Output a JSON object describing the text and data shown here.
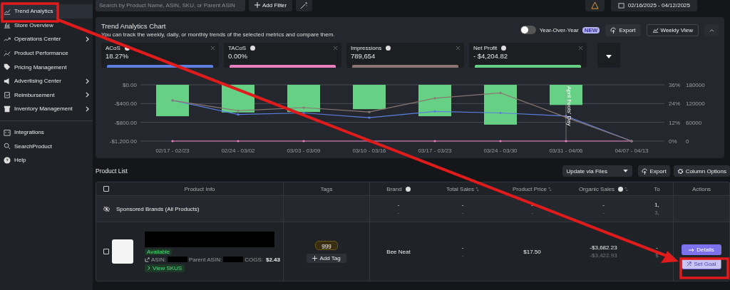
{
  "sidebar": {
    "items": [
      {
        "label": "Trend Analytics",
        "selected": true,
        "expandable": false
      },
      {
        "label": "Store Overview",
        "selected": false,
        "expandable": false
      },
      {
        "label": "Operations Center",
        "selected": false,
        "expandable": true
      },
      {
        "label": "Product Performance",
        "selected": false,
        "expandable": false
      },
      {
        "label": "Pricing Management",
        "selected": false,
        "expandable": false
      },
      {
        "label": "Advertising Center",
        "selected": false,
        "expandable": true
      },
      {
        "label": "Reimbursement",
        "selected": false,
        "expandable": true
      },
      {
        "label": "Inventory Management",
        "selected": false,
        "expandable": true
      }
    ],
    "bottom_items": [
      {
        "label": "Integrations"
      },
      {
        "label": "SearchProduct"
      },
      {
        "label": "Help"
      }
    ]
  },
  "toolbar": {
    "search": {
      "placeholder": "Search by Product Name, ASIN, SKU, or Parent ASIN"
    },
    "add_filter": "Add Filter",
    "date_range": "02/16/2025 - 04/12/2025"
  },
  "chart_panel": {
    "title": "Trend Analytics Chart",
    "subtitle": "You can track the weekly, daily, or monthly trends of the selected metrics and compare them.",
    "year_over_year": {
      "label": "Year-Over-Year",
      "on": false,
      "badge": "NEW"
    },
    "export": "Export",
    "weekly_view": "Weekly View",
    "metrics": [
      {
        "value": "18.27%"
      },
      {
        "value": "0.00%"
      },
      {
        "value": "789,654"
      },
      {
        "value": "- $4,204.82"
      }
    ],
    "chart_data": {
      "type": "bar",
      "stacked": false,
      "categories": [
        "02/17 - 02/23",
        "02/24 - 03/02",
        "03/03 - 03/09",
        "03/10 - 03/16",
        "03/17 - 03/23",
        "03/24 - 03/30",
        "03/31 - 04/06",
        "04/07 - 04/13"
      ],
      "ylim": [
        -1200,
        0
      ],
      "yticks": [
        {
          "value": 0,
          "label": "$0.00"
        },
        {
          "value": -400,
          "label": "-$400.00"
        },
        {
          "value": -800,
          "label": "-$800.00"
        },
        {
          "value": -1200,
          "label": "-$1,200.00"
        }
      ],
      "y2lim": [
        0,
        36
      ],
      "y2ticks": [
        {
          "value": 36,
          "label": "36%"
        },
        {
          "value": 24,
          "label": "24%"
        },
        {
          "value": 12,
          "label": "12%"
        },
        {
          "value": 0,
          "label": "0%"
        }
      ],
      "y3lim": [
        0,
        180000
      ],
      "y3ticks": [
        180000,
        120000,
        60000,
        0
      ],
      "series": [
        {
          "name": "ACoS",
          "color": "#5b7fde",
          "type": "line",
          "axis": "y2",
          "values": [
            26,
            17,
            18,
            15,
            19,
            18,
            16,
            0
          ]
        },
        {
          "name": "TACoS",
          "color": "#e87fbf",
          "type": "line",
          "axis": "y2",
          "values": [
            0,
            0,
            0,
            0,
            0,
            0,
            0,
            0
          ]
        },
        {
          "name": "Impressions",
          "color": "#8a7772",
          "type": "line",
          "axis": "y3",
          "values": [
            130000,
            97000,
            107000,
            93000,
            137000,
            154000,
            76000,
            0
          ]
        },
        {
          "name": "Net Profit",
          "color": "#66d184",
          "type": "bar",
          "axis": "y",
          "values": [
            -670,
            -590,
            -580,
            -520,
            -670,
            -850,
            -430,
            0
          ]
        }
      ],
      "annotations": [
        {
          "x": "03/31 - 04/06",
          "text": "April Fools' Day"
        }
      ]
    }
  },
  "product_list": {
    "title": "Product List",
    "update_select": "Update via Files",
    "export": "Export",
    "column_options": "Column Options",
    "select_all_checked": false,
    "columns": [
      "Product Info",
      "Tags",
      "Brand",
      "Total Sales",
      "Product Price",
      "Organic Sales",
      "To",
      "Actions"
    ],
    "rows": [
      {
        "kind": "summary",
        "name": "Sponsored Brands (All Products)",
        "brand": [
          "-",
          "-"
        ],
        "total_sales": [
          "-",
          "-"
        ],
        "price": [
          "-",
          "-"
        ],
        "organic": [
          "-",
          "-"
        ],
        "column_7": [
          "1,",
          "3,"
        ]
      },
      {
        "kind": "product",
        "checked": false,
        "status": "Available",
        "asin_label": "ASIN:",
        "parent_label": "Parent ASIN:",
        "cogs_label": "COGS:",
        "cogs": "$2.43",
        "view_skus": "View SKUS",
        "tag": "ggg",
        "add_tag": "Add Tag",
        "brand": "Bee Neat",
        "total_sales": [
          "-",
          "-"
        ],
        "price": "$17.50",
        "organic": [
          "-$3,682.23",
          "-$3,422.93"
        ],
        "column_7": [
          "-",
          "$"
        ],
        "details": "Details",
        "set_goal": "Set Goal"
      }
    ]
  }
}
